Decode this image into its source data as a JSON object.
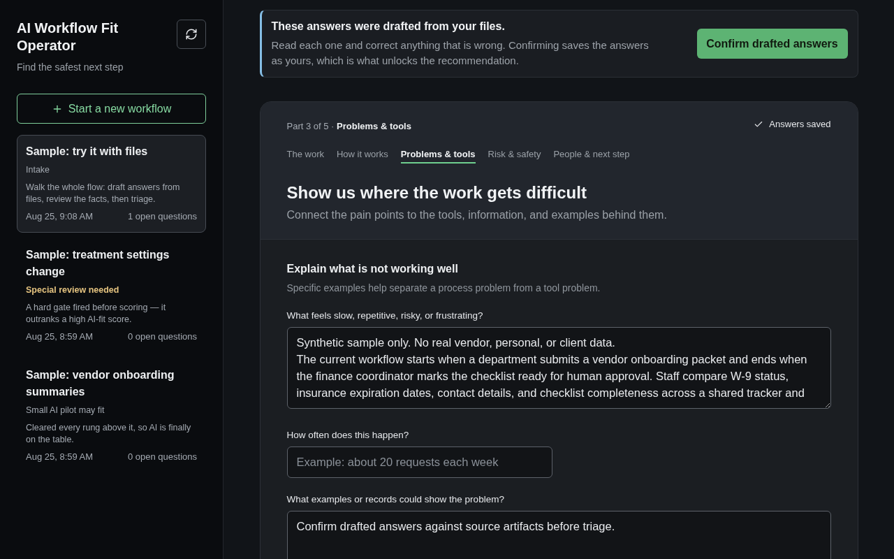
{
  "sidebar": {
    "title": "AI Workflow Fit Operator",
    "subtitle": "Find the safest next step",
    "new_button": "Start a new workflow",
    "workflows": [
      {
        "title": "Sample: try it with files",
        "status": {
          "text": "Intake",
          "kind": "neutral"
        },
        "description": "Walk the whole flow: draft answers from files, review the facts, then triage.",
        "time": "Aug 25, 9:08 AM",
        "open_questions": "1 open questions",
        "selected": true
      },
      {
        "title": "Sample: treatment settings change",
        "status": {
          "text": "Special review needed",
          "kind": "warning"
        },
        "description": "A hard gate fired before scoring — it outranks a high AI-fit score.",
        "time": "Aug 25, 8:59 AM",
        "open_questions": "0 open questions",
        "selected": false
      },
      {
        "title": "Sample: vendor onboarding summaries",
        "status": {
          "text": "Small AI pilot may fit",
          "kind": "neutral"
        },
        "description": "Cleared every rung above it, so AI is finally on the table.",
        "time": "Aug 25, 8:59 AM",
        "open_questions": "0 open questions",
        "selected": false
      }
    ]
  },
  "banner": {
    "title": "These answers were drafted from your files.",
    "text": "Read each one and correct anything that is wrong. Confirming saves the answers as yours, which is what unlocks the recommendation.",
    "button": "Confirm drafted answers"
  },
  "form": {
    "progress": "Part 3 of 5 · **Problems & tools**",
    "save_status": "Answers saved",
    "tabs": [
      {
        "label": "The work",
        "selected": false
      },
      {
        "label": "How it works",
        "selected": false
      },
      {
        "label": "Problems & tools",
        "selected": true
      },
      {
        "label": "Risk & safety",
        "selected": false
      },
      {
        "label": "People & next step",
        "selected": false
      }
    ],
    "heading": "Show us where the work gets difficult",
    "subheading": "Connect the pain points to the tools, information, and examples behind them.",
    "group": {
      "title": "Explain what is not working well",
      "hint": "Specific examples help separate a process problem from a tool problem."
    },
    "fields": [
      {
        "kind": "textarea",
        "label": "What feels slow, repetitive, risky, or frustrating?",
        "value": "Synthetic sample only. No real vendor, personal, or client data.\nThe current workflow starts when a department submits a vendor onboarding packet and ends when the finance coordinator marks the checklist ready for human approval. Staff compare W-9 status, insurance expiration dates, contact details, and checklist completeness across a shared tracker and"
      },
      {
        "kind": "input",
        "label": "How often does this happen?",
        "placeholder": "Example: about 20 requests each week"
      },
      {
        "kind": "textarea",
        "label": "What examples or records could show the problem?",
        "value": "Confirm drafted answers against source artifacts before triage."
      }
    ]
  }
}
